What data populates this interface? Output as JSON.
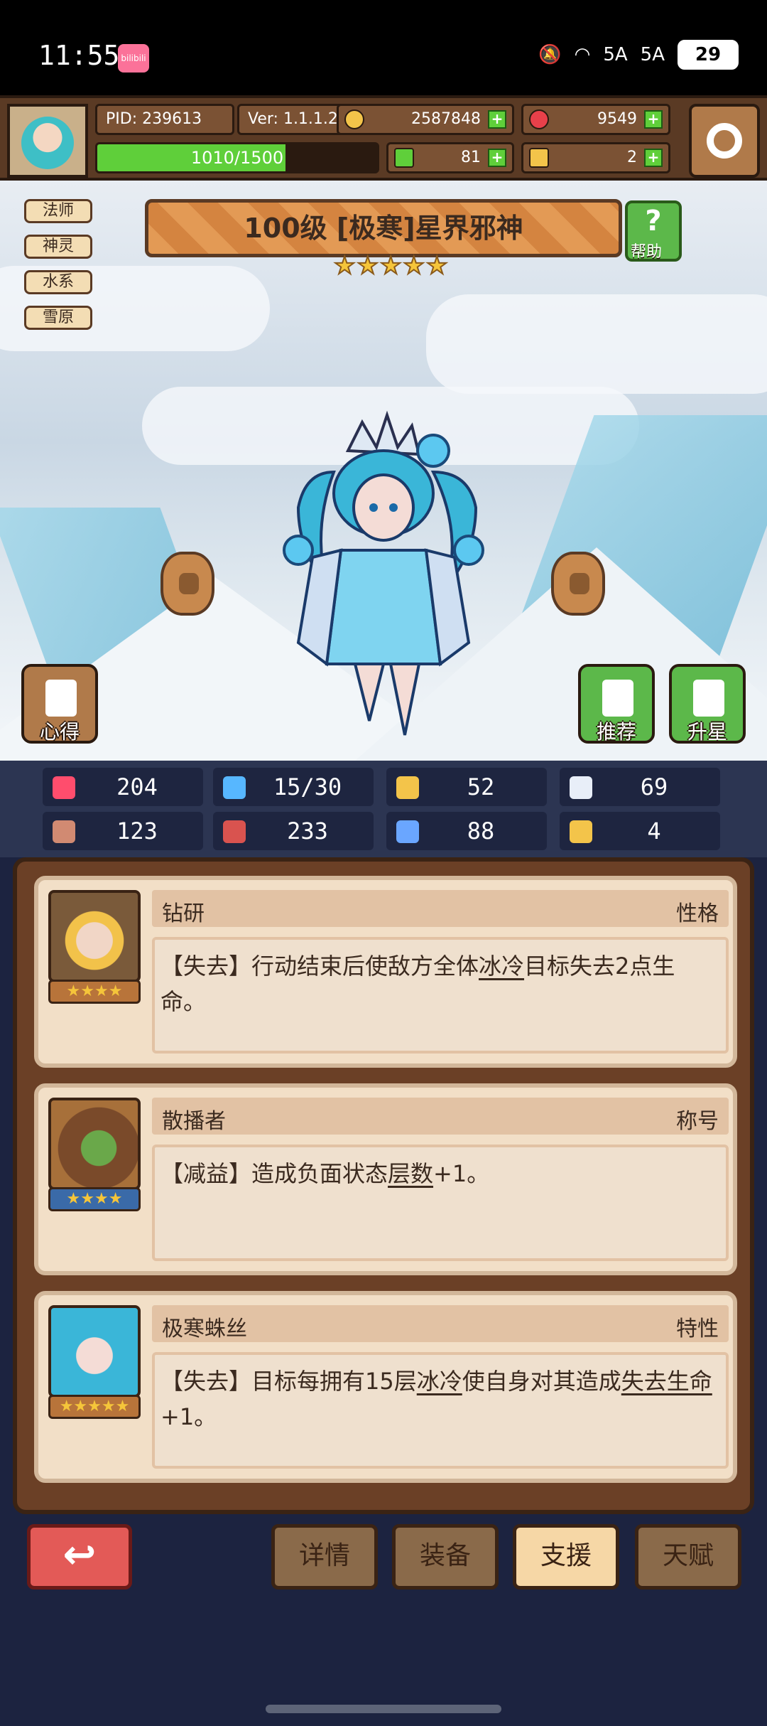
{
  "status_bar": {
    "time": "11:55",
    "app_badge": "bilibili",
    "signal_1": "5A",
    "signal_2": "5A",
    "battery": "29"
  },
  "player": {
    "pid": "PID: 239613",
    "version": "Ver: 1.1.1.2",
    "gold": "2587848",
    "gems": "9549",
    "clover": "81",
    "keys": "2",
    "xp_text": "1010/1500",
    "xp_progress": 0.6733
  },
  "hero": {
    "title": "100级 [极寒]星界邪神",
    "stars": 5,
    "help_label": "帮助",
    "tags": [
      "法师",
      "神灵",
      "水系",
      "雪原"
    ],
    "left_button_label": "心得",
    "recommend_label": "推荐",
    "upgrade_label": "升星"
  },
  "stats": [
    {
      "icon": "heart-icon",
      "value": "204",
      "color": "#ff4d6d"
    },
    {
      "icon": "water-drop-icon",
      "value": "15/30",
      "color": "#57b7ff"
    },
    {
      "icon": "shield-icon",
      "value": "52",
      "color": "#f3c44a"
    },
    {
      "icon": "wing-icon",
      "value": "69",
      "color": "#e8eef8"
    },
    {
      "icon": "fist-icon",
      "value": "123",
      "color": "#d18a72"
    },
    {
      "icon": "book-icon",
      "value": "233",
      "color": "#d9534f"
    },
    {
      "icon": "scroll-icon",
      "value": "88",
      "color": "#6aa6ff"
    },
    {
      "icon": "horseshoe-icon",
      "value": "4",
      "color": "#f3c44a"
    }
  ],
  "cards": [
    {
      "name": "钻研",
      "kind": "性格",
      "stars": "★★★★",
      "desc_html_parts": [
        "【失去】行动结束后使敌方全体",
        "冰冷",
        "目标失去2点生命。"
      ]
    },
    {
      "name": "散播者",
      "kind": "称号",
      "stars": "★★★★",
      "desc_html_parts": [
        "【减益】造成负面状态",
        "层数",
        "+1。"
      ]
    },
    {
      "name": "极寒蛛丝",
      "kind": "特性",
      "stars": "★★★★★",
      "desc_html_parts": [
        "【失去】目标每拥有15层",
        "冰冷",
        "使自身对其造成",
        "失去生命",
        "+1。"
      ]
    }
  ],
  "nav": {
    "back_symbol": "↩",
    "tabs": [
      {
        "label": "详情",
        "active": false
      },
      {
        "label": "装备",
        "active": false
      },
      {
        "label": "支援",
        "active": true
      },
      {
        "label": "天赋",
        "active": false
      }
    ]
  }
}
